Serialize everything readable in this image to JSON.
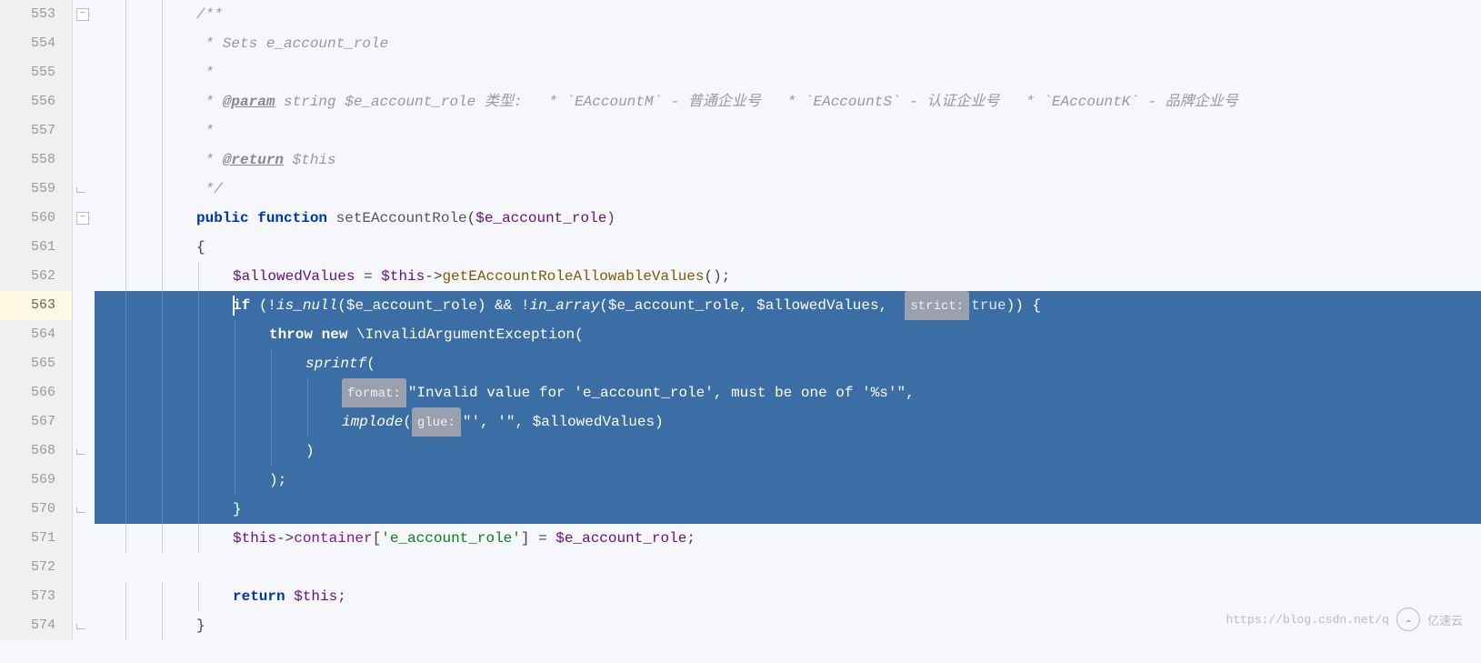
{
  "lines": [
    {
      "num": "553",
      "fold": "minus",
      "type": "comment",
      "indent": 2,
      "selected": false,
      "tokens": [
        {
          "t": "comment",
          "v": "/**"
        }
      ]
    },
    {
      "num": "554",
      "type": "comment",
      "indent": 2,
      "selected": false,
      "tokens": [
        {
          "t": "comment",
          "v": " * Sets e_account_role"
        }
      ]
    },
    {
      "num": "555",
      "type": "comment",
      "indent": 2,
      "selected": false,
      "tokens": [
        {
          "t": "comment",
          "v": " *"
        }
      ]
    },
    {
      "num": "556",
      "type": "comment",
      "indent": 2,
      "selected": false,
      "tokens": [
        {
          "t": "comment",
          "v": " * "
        },
        {
          "t": "doctag",
          "v": "@param"
        },
        {
          "t": "comment",
          "v": " string $e_account_role 类型:   * `EAccountM` - 普通企业号   * `EAccountS` - 认证企业号   * `EAccountK` - 品牌企业号"
        }
      ]
    },
    {
      "num": "557",
      "type": "comment",
      "indent": 2,
      "selected": false,
      "tokens": [
        {
          "t": "comment",
          "v": " *"
        }
      ]
    },
    {
      "num": "558",
      "type": "comment",
      "indent": 2,
      "selected": false,
      "tokens": [
        {
          "t": "comment",
          "v": " * "
        },
        {
          "t": "doctag",
          "v": "@return"
        },
        {
          "t": "comment",
          "v": " $this"
        }
      ]
    },
    {
      "num": "559",
      "fold": "end",
      "type": "comment",
      "indent": 2,
      "selected": false,
      "tokens": [
        {
          "t": "comment",
          "v": " */"
        }
      ]
    },
    {
      "num": "560",
      "fold": "minus",
      "indent": 2,
      "selected": false,
      "tokens": [
        {
          "t": "keyword",
          "v": "public function "
        },
        {
          "t": "func",
          "v": "setEAccountRole"
        },
        {
          "t": "punc",
          "v": "("
        },
        {
          "t": "var",
          "v": "$e_account_role"
        },
        {
          "t": "punc",
          "v": ")"
        }
      ]
    },
    {
      "num": "561",
      "indent": 2,
      "selected": false,
      "tokens": [
        {
          "t": "punc",
          "v": "{"
        }
      ]
    },
    {
      "num": "562",
      "indent": 3,
      "selected": false,
      "tokens": [
        {
          "t": "var",
          "v": "$allowedValues"
        },
        {
          "t": "punc",
          "v": " = "
        },
        {
          "t": "var",
          "v": "$this"
        },
        {
          "t": "punc",
          "v": "->"
        },
        {
          "t": "method",
          "v": "getEAccountRoleAllowableValues"
        },
        {
          "t": "punc",
          "v": "();"
        }
      ]
    },
    {
      "num": "563",
      "current": true,
      "indent": 3,
      "selected": true,
      "cursor": 3,
      "tokens": [
        {
          "t": "keyword",
          "v": "if "
        },
        {
          "t": "punc",
          "v": "(!"
        },
        {
          "t": "builtin",
          "v": "is_null"
        },
        {
          "t": "punc",
          "v": "("
        },
        {
          "t": "var",
          "v": "$e_account_role"
        },
        {
          "t": "punc",
          "v": ") && !"
        },
        {
          "t": "builtin",
          "v": "in_array"
        },
        {
          "t": "punc",
          "v": "("
        },
        {
          "t": "var",
          "v": "$e_account_role"
        },
        {
          "t": "punc",
          "v": ", "
        },
        {
          "t": "var",
          "v": "$allowedValues"
        },
        {
          "t": "punc",
          "v": ",  "
        },
        {
          "t": "hint",
          "v": "strict:"
        },
        {
          "t": "bool",
          "v": "true"
        },
        {
          "t": "punc",
          "v": ")) {"
        }
      ]
    },
    {
      "num": "564",
      "indent": 4,
      "selected": true,
      "tokens": [
        {
          "t": "keyword",
          "v": "throw new "
        },
        {
          "t": "punc",
          "v": "\\InvalidArgumentException("
        }
      ]
    },
    {
      "num": "565",
      "indent": 5,
      "selected": true,
      "tokens": [
        {
          "t": "builtin",
          "v": "sprintf"
        },
        {
          "t": "punc",
          "v": "("
        }
      ]
    },
    {
      "num": "566",
      "indent": 6,
      "selected": true,
      "tokens": [
        {
          "t": "hint",
          "v": "format:"
        },
        {
          "t": "string",
          "v": "\"Invalid value for 'e_account_role', must be one of '%s'\""
        },
        {
          "t": "punc",
          "v": ","
        }
      ]
    },
    {
      "num": "567",
      "indent": 6,
      "selected": true,
      "tokens": [
        {
          "t": "builtin",
          "v": "implode"
        },
        {
          "t": "punc",
          "v": "("
        },
        {
          "t": "hint",
          "v": "glue:"
        },
        {
          "t": "string",
          "v": "\"', '\""
        },
        {
          "t": "punc",
          "v": ", "
        },
        {
          "t": "var",
          "v": "$allowedValues"
        },
        {
          "t": "punc",
          "v": ")"
        }
      ]
    },
    {
      "num": "568",
      "fold": "end",
      "indent": 5,
      "selected": true,
      "tokens": [
        {
          "t": "punc",
          "v": ")"
        }
      ]
    },
    {
      "num": "569",
      "indent": 4,
      "selected": true,
      "tokens": [
        {
          "t": "punc",
          "v": ");"
        }
      ]
    },
    {
      "num": "570",
      "fold": "end",
      "indent": 3,
      "selected": true,
      "tokens": [
        {
          "t": "punc",
          "v": "}"
        }
      ]
    },
    {
      "num": "571",
      "indent": 3,
      "selected": false,
      "tokens": [
        {
          "t": "var",
          "v": "$this"
        },
        {
          "t": "punc",
          "v": "->"
        },
        {
          "t": "prop",
          "v": "container"
        },
        {
          "t": "punc",
          "v": "["
        },
        {
          "t": "string",
          "v": "'e_account_role'"
        },
        {
          "t": "punc",
          "v": "] = "
        },
        {
          "t": "var",
          "v": "$e_account_role"
        },
        {
          "t": "punc",
          "v": ";"
        }
      ]
    },
    {
      "num": "572",
      "indent": 0,
      "selected": false,
      "tokens": []
    },
    {
      "num": "573",
      "indent": 3,
      "selected": false,
      "tokens": [
        {
          "t": "keyword",
          "v": "return "
        },
        {
          "t": "var",
          "v": "$this"
        },
        {
          "t": "punc",
          "v": ";"
        }
      ]
    },
    {
      "num": "574",
      "fold": "end",
      "indent": 2,
      "selected": false,
      "tokens": [
        {
          "t": "punc",
          "v": "}"
        }
      ]
    }
  ],
  "watermark": {
    "url": "https://blog.csdn.net/q",
    "brand": "亿速云"
  },
  "indent_width": 40,
  "base_indent": 32
}
